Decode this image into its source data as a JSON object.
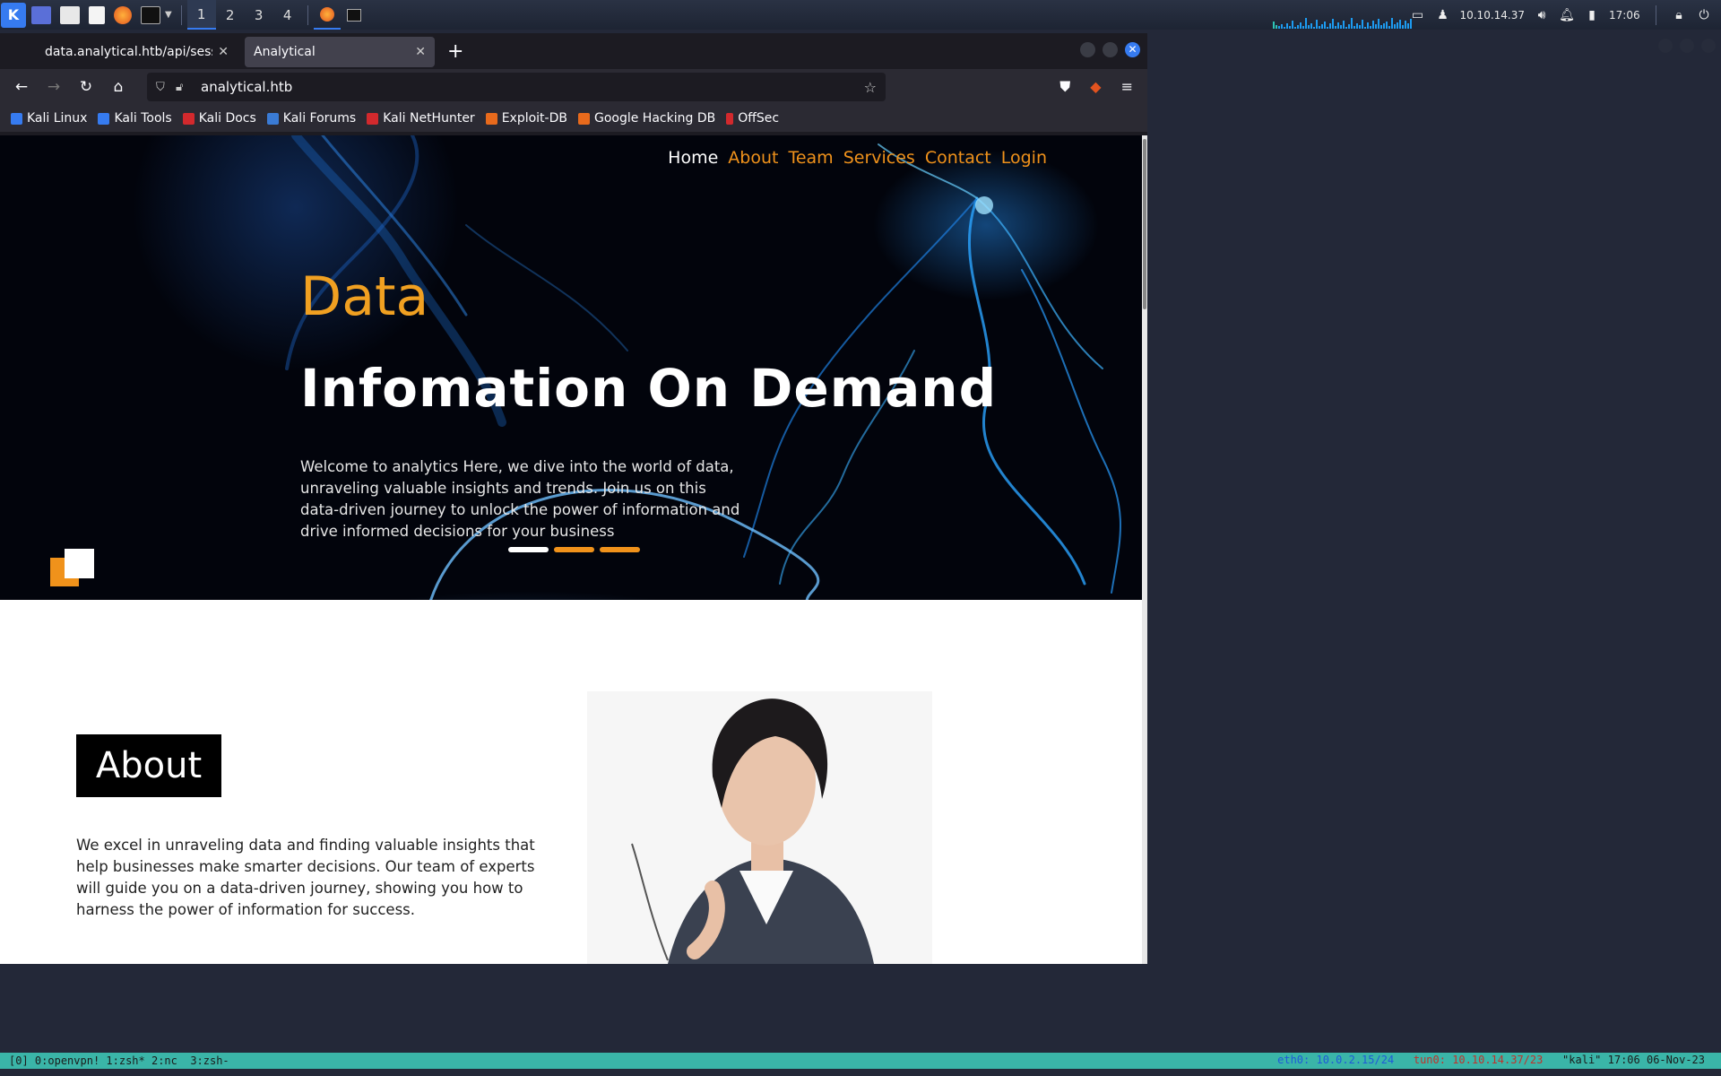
{
  "panel": {
    "workspaces": [
      "1",
      "2",
      "3",
      "4"
    ],
    "ip": "10.10.14.37",
    "time": "17:06"
  },
  "browser": {
    "tabs": [
      {
        "title": "data.analytical.htb/api/session",
        "active": false
      },
      {
        "title": "Analytical",
        "active": true
      }
    ],
    "url": "analytical.htb",
    "bookmarks": [
      "Kali Linux",
      "Kali Tools",
      "Kali Docs",
      "Kali Forums",
      "Kali NetHunter",
      "Exploit-DB",
      "Google Hacking DB",
      "OffSec"
    ]
  },
  "page": {
    "nav": {
      "home": "Home",
      "about": "About",
      "team": "Team",
      "services": "Services",
      "contact": "Contact",
      "login": "Login"
    },
    "hero": {
      "subtitle": "Data",
      "title": "Infomation On Demand",
      "text": "Welcome to analytics Here, we dive into the world of data, unraveling valuable insights and trends. Join us on this data-driven journey to unlock the power of information and drive informed decisions for your business"
    },
    "about": {
      "heading": "About",
      "text": "We excel in unraveling data and finding valuable insights that help businesses make smarter decisions. Our team of experts will guide you on a data-driven journey, showing you how to harness the power of information for success."
    }
  },
  "tmux": {
    "session": "[0]",
    "windows": "0:openvpn! 1:zsh* 2:nc  3:zsh-",
    "eth0": "eth0: 10.0.2.15/24",
    "tun0": "tun0: 10.10.14.37/23",
    "host": "\"kali\" 17:06 06-Nov-23"
  },
  "colors": {
    "accent": "#f0921b",
    "kali_blue": "#367bf0",
    "tmux_bar": "#3ab5a8"
  }
}
